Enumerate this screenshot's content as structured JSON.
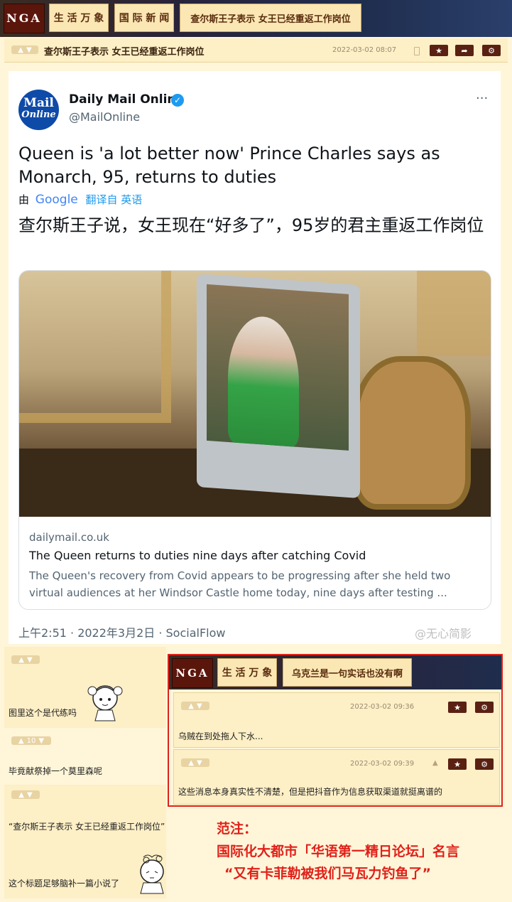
{
  "header": {
    "logo": "NGA",
    "tabs": [
      "生 活 万 象",
      "国 际 新 闻",
      "查尔斯王子表示 女王已经重返工作岗位"
    ]
  },
  "post": {
    "title": "查尔斯王子表示 女王已经重返工作岗位",
    "timestamp": "2022-03-02 08:07",
    "actions": [
      "star-icon",
      "share-icon",
      "settings-icon"
    ]
  },
  "tweet": {
    "account_name": "Daily Mail Online",
    "handle": "@MailOnline",
    "avatar_line1": "Mail",
    "avatar_line2": "Online",
    "more": "···",
    "text_en": "Queen is 'a lot better now' Prince Charles says as Monarch, 95, returns to duties",
    "translate_by": "由",
    "translate_google": "Google",
    "translate_link": "翻译自 英语",
    "text_zh": "查尔斯王子说，女王现在“好多了”，95岁的君主重返工作岗位",
    "card_domain": "dailymail.co.uk",
    "card_title": "The Queen returns to duties nine days after catching Covid",
    "card_desc": "The Queen's recovery from Covid appears to be progressing after she held two virtual audiences at her Windsor Castle home today, nine days after testing ...",
    "footer": "上午2:51 · 2022年3月2日 · SocialFlow",
    "watermark": "@无心简影"
  },
  "comments": [
    {
      "likes": "",
      "text": "图里这个是代练吗"
    },
    {
      "likes": "10",
      "text": "毕竟献祭掉一个莫里森呢"
    },
    {
      "likes": "",
      "text": "“查尔斯王子表示 女王已经重返工作岗位”"
    },
    {
      "likes": "",
      "text": "这个标题足够脑补一篇小说了"
    }
  ],
  "embedded": {
    "logo": "NGA",
    "tab1": "生 活 万 象",
    "tab2": "乌克兰是一句实话也没有啊",
    "replies": [
      {
        "timestamp": "2022-03-02 09:36",
        "text": "乌贼在到处拖人下水..."
      },
      {
        "timestamp": "2022-03-02 09:39",
        "text": "这些消息本身真实性不清楚，但是把抖音作为信息获取渠道就挺离谱的"
      }
    ]
  },
  "note": {
    "line1": "范注：",
    "line2": "国际化大都市「华语第一精日论坛」名言",
    "line3": "“又有卡菲勒被我们马瓦力钓鱼了”"
  },
  "colors": {
    "accent": "#5b160c",
    "note_red": "#e0211a",
    "twitter_blue": "#1d9bf0"
  }
}
